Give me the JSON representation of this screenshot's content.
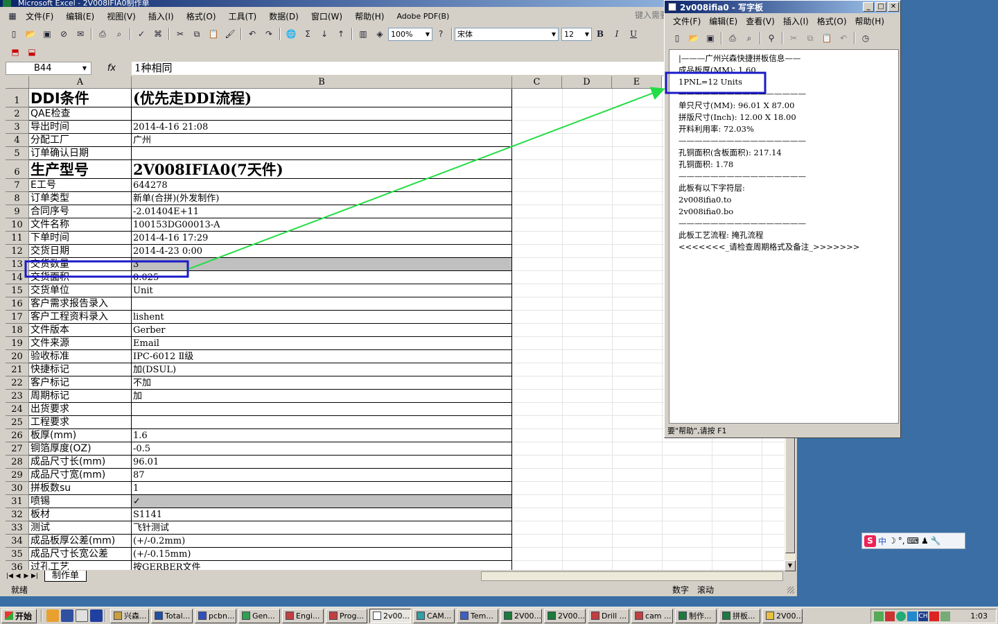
{
  "excel": {
    "title": "Microsoft Excel - 2V008IFIA0制作单",
    "ask_box": "键入需要",
    "menu": [
      {
        "label": "文件(F)"
      },
      {
        "label": "编辑(E)"
      },
      {
        "label": "视图(V)"
      },
      {
        "label": "插入(I)"
      },
      {
        "label": "格式(O)"
      },
      {
        "label": "工具(T)"
      },
      {
        "label": "数据(D)"
      },
      {
        "label": "窗口(W)"
      },
      {
        "label": "帮助(H)"
      },
      {
        "label": "Adobe PDF(B)"
      }
    ],
    "zoom": "100%",
    "font_name": "宋体",
    "font_size": "12",
    "name_box": "B44",
    "fx": "fx",
    "formula": "1种相同",
    "columns": [
      "A",
      "B",
      "C",
      "D",
      "E"
    ],
    "rows": [
      {
        "n": "1",
        "a": "DDI条件",
        "b": "(优先走DDI流程)"
      },
      {
        "n": "2",
        "a": "QAE检查",
        "b": ""
      },
      {
        "n": "3",
        "a": "导出时间",
        "b": "2014-4-16 21:08"
      },
      {
        "n": "4",
        "a": "分配工厂",
        "b": "广州"
      },
      {
        "n": "5",
        "a": "订单确认日期",
        "b": ""
      },
      {
        "n": "6",
        "a": "生产型号",
        "b": "2V008IFIA0(7天件)"
      },
      {
        "n": "7",
        "a": "E工号",
        "b": "644278"
      },
      {
        "n": "8",
        "a": "订单类型",
        "b": "新单(合拼)(外发制作)"
      },
      {
        "n": "9",
        "a": "合同序号",
        "b": "-2.01404E+11"
      },
      {
        "n": "10",
        "a": "文件名称",
        "b": "100153DG00013-A"
      },
      {
        "n": "11",
        "a": "下单时间",
        "b": "2014-4-16 17:29"
      },
      {
        "n": "12",
        "a": "交货日期",
        "b": "2014-4-23 0:00"
      },
      {
        "n": "13",
        "a": "交货数量",
        "b": "3"
      },
      {
        "n": "14",
        "a": "交货面积",
        "b": "0.025"
      },
      {
        "n": "15",
        "a": "交货单位",
        "b": "Unit"
      },
      {
        "n": "16",
        "a": "客户需求报告录入",
        "b": ""
      },
      {
        "n": "17",
        "a": "客户工程资料录入",
        "b": "lishent"
      },
      {
        "n": "18",
        "a": "文件版本",
        "b": "Gerber"
      },
      {
        "n": "19",
        "a": "文件来源",
        "b": "Email"
      },
      {
        "n": "20",
        "a": "验收标准",
        "b": "IPC-6012 Ⅱ级"
      },
      {
        "n": "21",
        "a": "快捷标记",
        "b": "加(DSUL)"
      },
      {
        "n": "22",
        "a": "客户标记",
        "b": "不加"
      },
      {
        "n": "23",
        "a": "周期标记",
        "b": "加"
      },
      {
        "n": "24",
        "a": "出货要求",
        "b": ""
      },
      {
        "n": "25",
        "a": "工程要求",
        "b": ""
      },
      {
        "n": "26",
        "a": "板厚(mm)",
        "b": "1.6"
      },
      {
        "n": "27",
        "a": "铜箔厚度(OZ)",
        "b": "-0.5"
      },
      {
        "n": "28",
        "a": "成品尺寸长(mm)",
        "b": "96.01"
      },
      {
        "n": "29",
        "a": "成品尺寸宽(mm)",
        "b": "87"
      },
      {
        "n": "30",
        "a": "拼板数su",
        "b": "1"
      },
      {
        "n": "31",
        "a": "喷锡",
        "b": "✓"
      },
      {
        "n": "32",
        "a": "板材",
        "b": "S1141"
      },
      {
        "n": "33",
        "a": "测试",
        "b": "飞针测试"
      },
      {
        "n": "34",
        "a": "成品板厚公差(mm)",
        "b": "(+/-0.2mm)"
      },
      {
        "n": "35",
        "a": "成品尺寸长宽公差",
        "b": "(+/-0.15mm)"
      },
      {
        "n": "36",
        "a": "过孔工艺",
        "b": "按GERBER文件"
      }
    ],
    "sheet_tab": "制作单",
    "status_ready": "就绪",
    "status_num": "数字",
    "status_scroll": "滚动"
  },
  "wordpad": {
    "title": "2v008ifia0 - 写字板",
    "menu": [
      {
        "label": "文件(F)"
      },
      {
        "label": "编辑(E)"
      },
      {
        "label": "查看(V)"
      },
      {
        "label": "插入(I)"
      },
      {
        "label": "格式(O)"
      },
      {
        "label": "帮助(H)"
      }
    ],
    "lines": [
      "|———广州兴森快捷拼板信息——",
      "成品板厚(MM): 1.60",
      "1PNL=12 Units",
      "————————————————",
      "单只尺寸(MM): 96.01 X 87.00",
      "拼版尺寸(Inch): 12.00 X 18.00",
      "开料利用率: 72.03%",
      "————————————————",
      "孔铜面积(含板面积): 217.14",
      "孔铜面积: 1.78",
      "————————————————",
      "此板有以下字符层:",
      "2v008ifia0.to",
      "2v008ifia0.bo",
      "————————————————",
      "此板工艺流程: 掩孔流程",
      "<<<<<<<_请检查周期格式及备注_>>>>>>>"
    ],
    "status": "要\"帮助\",请按 F1"
  },
  "ime": {
    "logo": "S",
    "mode": "中"
  },
  "taskbar": {
    "start": "开始",
    "tasks": [
      {
        "label": "兴森...",
        "color": "#c8a040"
      },
      {
        "label": "Total...",
        "color": "#2050a0"
      },
      {
        "label": "pcbn...",
        "color": "#3050c0"
      },
      {
        "label": "Gen...",
        "color": "#30a050"
      },
      {
        "label": "Engi...",
        "color": "#c04040"
      },
      {
        "label": "Prog...",
        "color": "#c04040"
      },
      {
        "label": "2v00...",
        "color": "#ffffff"
      },
      {
        "label": "CAM...",
        "color": "#30a0a0"
      },
      {
        "label": "Tem...",
        "color": "#4060c0"
      },
      {
        "label": "2V00...",
        "color": "#1c7a3c"
      },
      {
        "label": "2V00...",
        "color": "#1c7a3c"
      },
      {
        "label": "Drill ...",
        "color": "#c04040"
      },
      {
        "label": "cam ...",
        "color": "#c04040"
      },
      {
        "label": "制作...",
        "color": "#1c7a3c"
      },
      {
        "label": "拼板...",
        "color": "#1c7a3c"
      },
      {
        "label": "2V00...",
        "color": "#e8c040"
      }
    ],
    "clock": "1:03",
    "lang": "CH"
  },
  "colors": {
    "highlight_box": "#1a1ac8",
    "arrow": "#22dd44",
    "title_bar": "#0a246a"
  }
}
